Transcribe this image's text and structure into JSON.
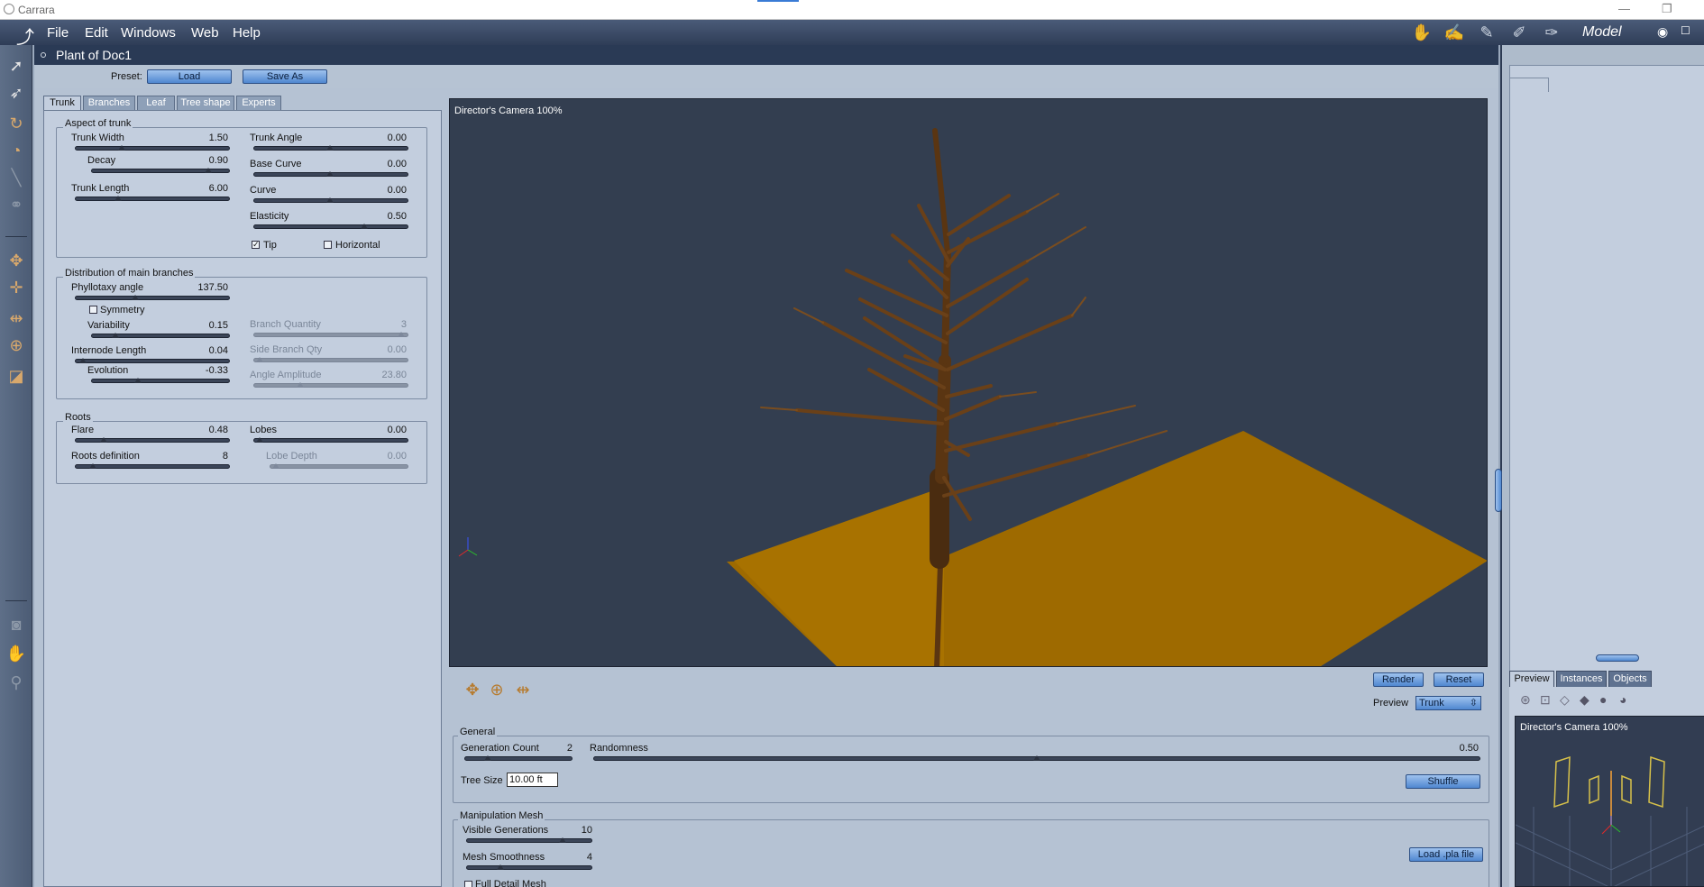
{
  "window": {
    "title": "Carrara",
    "minimize": "—",
    "restore": "❐"
  },
  "menu": {
    "items": [
      "File",
      "Edit",
      "Windows",
      "Web",
      "Help"
    ],
    "room": "Model"
  },
  "plant": {
    "title": "Plant of Doc1",
    "preset_label": "Preset:",
    "load_button": "Load",
    "save_as_button": "Save As"
  },
  "tabs": [
    "Trunk",
    "Branches",
    "Leaf",
    "Tree shape",
    "Experts"
  ],
  "aspect_of_trunk": {
    "title": "Aspect of trunk",
    "trunk_width": {
      "label": "Trunk Width",
      "value": "1.50"
    },
    "decay": {
      "label": "Decay",
      "value": "0.90"
    },
    "trunk_length": {
      "label": "Trunk Length",
      "value": "6.00"
    },
    "trunk_angle": {
      "label": "Trunk Angle",
      "value": "0.00"
    },
    "base_curve": {
      "label": "Base Curve",
      "value": "0.00"
    },
    "curve": {
      "label": "Curve",
      "value": "0.00"
    },
    "elasticity": {
      "label": "Elasticity",
      "value": "0.50"
    },
    "tip": {
      "label": "Tip",
      "checked": true
    },
    "horizontal": {
      "label": "Horizontal",
      "checked": false
    }
  },
  "distribution": {
    "title": "Distribution of main branches",
    "phyllotaxy_angle": {
      "label": "Phyllotaxy angle",
      "value": "137.50"
    },
    "symmetry": {
      "label": "Symmetry",
      "checked": false
    },
    "variability": {
      "label": "Variability",
      "value": "0.15"
    },
    "internode_length": {
      "label": "Internode Length",
      "value": "0.04"
    },
    "evolution": {
      "label": "Evolution",
      "value": "-0.33"
    },
    "branch_quantity": {
      "label": "Branch Quantity",
      "value": "3"
    },
    "side_branch_qty": {
      "label": "Side Branch Qty",
      "value": "0.00"
    },
    "angle_amplitude": {
      "label": "Angle Amplitude",
      "value": "23.80"
    }
  },
  "roots": {
    "title": "Roots",
    "flare": {
      "label": "Flare",
      "value": "0.48"
    },
    "roots_definition": {
      "label": "Roots definition",
      "value": "8"
    },
    "lobes": {
      "label": "Lobes",
      "value": "0.00"
    },
    "lobe_depth": {
      "label": "Lobe Depth",
      "value": "0.00"
    }
  },
  "viewport": {
    "camera_label": "Director's Camera 100%"
  },
  "render_controls": {
    "render_button": "Render",
    "reset_button": "Reset",
    "preview_label": "Preview",
    "preview_value": "Trunk"
  },
  "general": {
    "title": "General",
    "generation_count": {
      "label": "Generation Count",
      "value": "2"
    },
    "randomness": {
      "label": "Randomness",
      "value": "0.50"
    },
    "tree_size_label": "Tree Size",
    "tree_size_value": "10.00 ft",
    "shuffle_button": "Shuffle"
  },
  "manipulation_mesh": {
    "title": "Manipulation Mesh",
    "visible_generations": {
      "label": "Visible Generations",
      "value": "10"
    },
    "mesh_smoothness": {
      "label": "Mesh Smoothness",
      "value": "4"
    },
    "full_detail_mesh": "Full Detail Mesh",
    "load_pla_button": "Load .pla file"
  },
  "right_panel": {
    "tabs": [
      "Preview",
      "Instances",
      "Objects"
    ],
    "camera_label": "Director's Camera 100%"
  },
  "colors": {
    "ground": "#9e6a00",
    "trunk": "#5a3512",
    "viewport_bg": "#333e50"
  }
}
